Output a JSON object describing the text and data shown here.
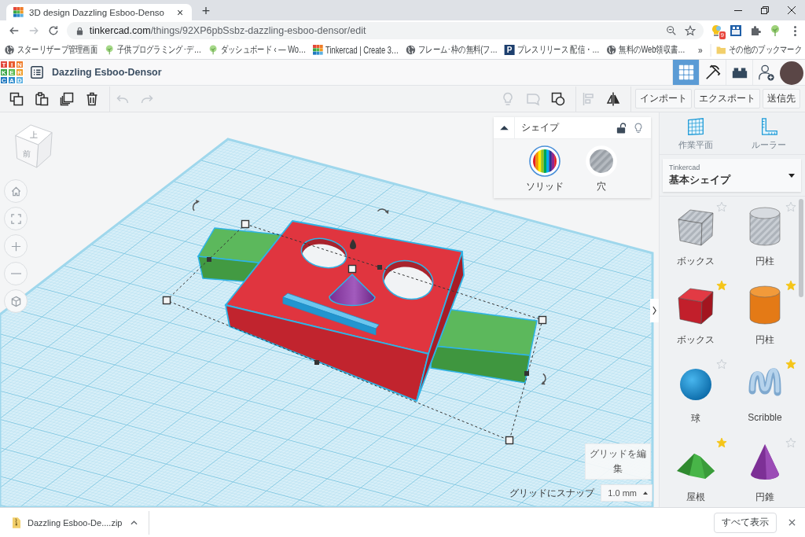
{
  "browser": {
    "tab": {
      "title": "3D design Dazzling Esboo-Denso",
      "close": "×"
    },
    "new_tab": "+",
    "address": {
      "host": "tinkercad.com",
      "path": "/things/92XP6pbSsbz-dazzling-esboo-densor/edit"
    },
    "extension_badge": "9",
    "bookmarks": [
      {
        "label": "スターリザーブ管理画面",
        "kind": "globe"
      },
      {
        "label": "子供プログラミング･デ…",
        "kind": "tree"
      },
      {
        "label": "ダッシュボード ‹ — Wo…",
        "kind": "tree"
      },
      {
        "label": "Tinkercad | Create 3…",
        "kind": "tinkercad"
      },
      {
        "label": "フレーム･枠の無料(フ…",
        "kind": "globe"
      },
      {
        "label": "プレスリリース 配信・…",
        "kind": "letter",
        "letter": "P"
      },
      {
        "label": "無料のWeb領収書…",
        "kind": "globe"
      }
    ],
    "bookmarks_overflow": "»",
    "other_bookmarks": "その他のブックマーク"
  },
  "app": {
    "logo": [
      "T",
      "I",
      "N",
      "K",
      "E",
      "R",
      "C",
      "A",
      "D"
    ],
    "title": "Dazzling Esboo-Densor",
    "nav": [
      {
        "kind": "grid",
        "selected": true
      },
      {
        "kind": "pickaxe",
        "selected": false
      },
      {
        "kind": "bricks",
        "selected": false
      }
    ]
  },
  "toolbar": {
    "edit_tools": [
      {
        "kind": "copy",
        "disabled": false
      },
      {
        "kind": "paste",
        "disabled": false
      },
      {
        "kind": "duplicate",
        "disabled": false
      },
      {
        "kind": "delete",
        "disabled": false
      },
      {
        "kind": "undo",
        "disabled": true
      },
      {
        "kind": "redo",
        "disabled": true
      }
    ],
    "view_tools": [
      {
        "kind": "note",
        "disabled": true
      },
      {
        "kind": "comment",
        "disabled": true
      },
      {
        "kind": "group",
        "disabled": false
      },
      {
        "kind": "align",
        "disabled": true
      },
      {
        "kind": "mirror",
        "disabled": false
      }
    ],
    "buttons": [
      "インポート",
      "エクスポート",
      "送信先"
    ]
  },
  "view_cube": {
    "top": "上",
    "front": "前"
  },
  "view_controls": [
    {
      "kind": "home"
    },
    {
      "kind": "fit"
    },
    {
      "kind": "zoom-in"
    },
    {
      "kind": "zoom-out"
    },
    {
      "kind": "perspective"
    }
  ],
  "shape_panel": {
    "title": "シェイプ",
    "expanded": true,
    "locked": false,
    "options": [
      {
        "label": "ソリッド",
        "kind": "solid",
        "selected": true
      },
      {
        "label": "穴",
        "kind": "hole",
        "selected": false
      }
    ]
  },
  "grid_controls": {
    "edit": "グリッドを編集",
    "snap_label": "グリッドにスナップ",
    "snap_value": "1.0 mm"
  },
  "library": {
    "tools": [
      {
        "label": "作業平面",
        "kind": "workplane"
      },
      {
        "label": "ルーラー",
        "kind": "ruler"
      }
    ],
    "source": "Tinkercad",
    "category": "基本シェイプ",
    "shapes": [
      {
        "label": "ボックス",
        "kind": "box-hole",
        "starred": false
      },
      {
        "label": "円柱",
        "kind": "cylinder-hole",
        "starred": false
      },
      {
        "label": "ボックス",
        "kind": "box",
        "starred": true
      },
      {
        "label": "円柱",
        "kind": "cylinder",
        "starred": true
      },
      {
        "label": "球",
        "kind": "sphere",
        "starred": false
      },
      {
        "label": "Scribble",
        "kind": "scribble",
        "starred": true
      },
      {
        "label": "屋根",
        "kind": "roof",
        "starred": true
      },
      {
        "label": "円錐",
        "kind": "cone",
        "starred": false
      }
    ]
  },
  "download": {
    "file": "Dazzling Esboo-De....zip",
    "show_all": "すべて表示"
  }
}
